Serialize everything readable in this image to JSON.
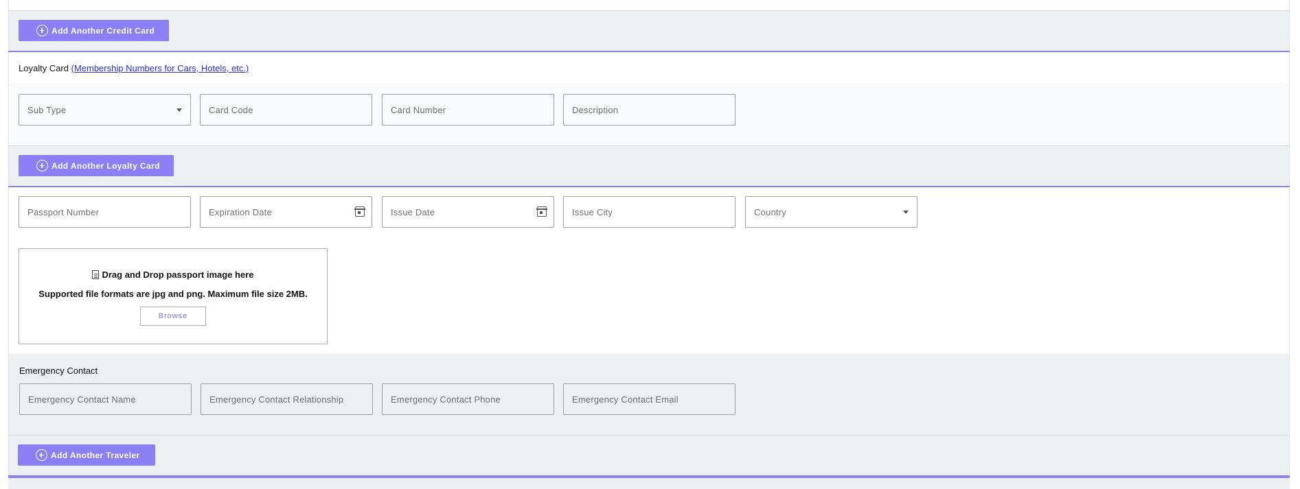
{
  "credit_card": {
    "add_button": "Add Another Credit Card"
  },
  "loyalty": {
    "heading": "Loyalty Card",
    "link": "(Membership Numbers for Cars, Hotels, etc.)",
    "fields": {
      "sub_type": "Sub Type",
      "card_code": "Card Code",
      "card_number": "Card Number",
      "description": "Description"
    },
    "add_button": "Add Another Loyalty Card"
  },
  "passport": {
    "fields": {
      "passport_number": "Passport Number",
      "expiration_date": "Expiration Date",
      "issue_date": "Issue Date",
      "issue_city": "Issue City",
      "country": "Country"
    },
    "dropzone": {
      "title": "Drag and Drop passport image here",
      "subtitle": "Supported file formats are jpg and png. Maximum file size 2MB.",
      "browse": "Browse"
    }
  },
  "emergency": {
    "heading": "Emergency Contact",
    "fields": {
      "name": "Emergency Contact Name",
      "relationship": "Emergency Contact Relationship",
      "phone": "Emergency Contact Phone",
      "email": "Emergency Contact Email"
    }
  },
  "traveler": {
    "add_button": "Add Another Traveler"
  },
  "colors": {
    "accent": "#8b7ff6",
    "band_gray": "#edf0f3",
    "link": "#2a2cd8"
  },
  "icons": [
    "plus-circle-icon",
    "chevron-down-icon",
    "calendar-icon",
    "document-icon"
  ]
}
